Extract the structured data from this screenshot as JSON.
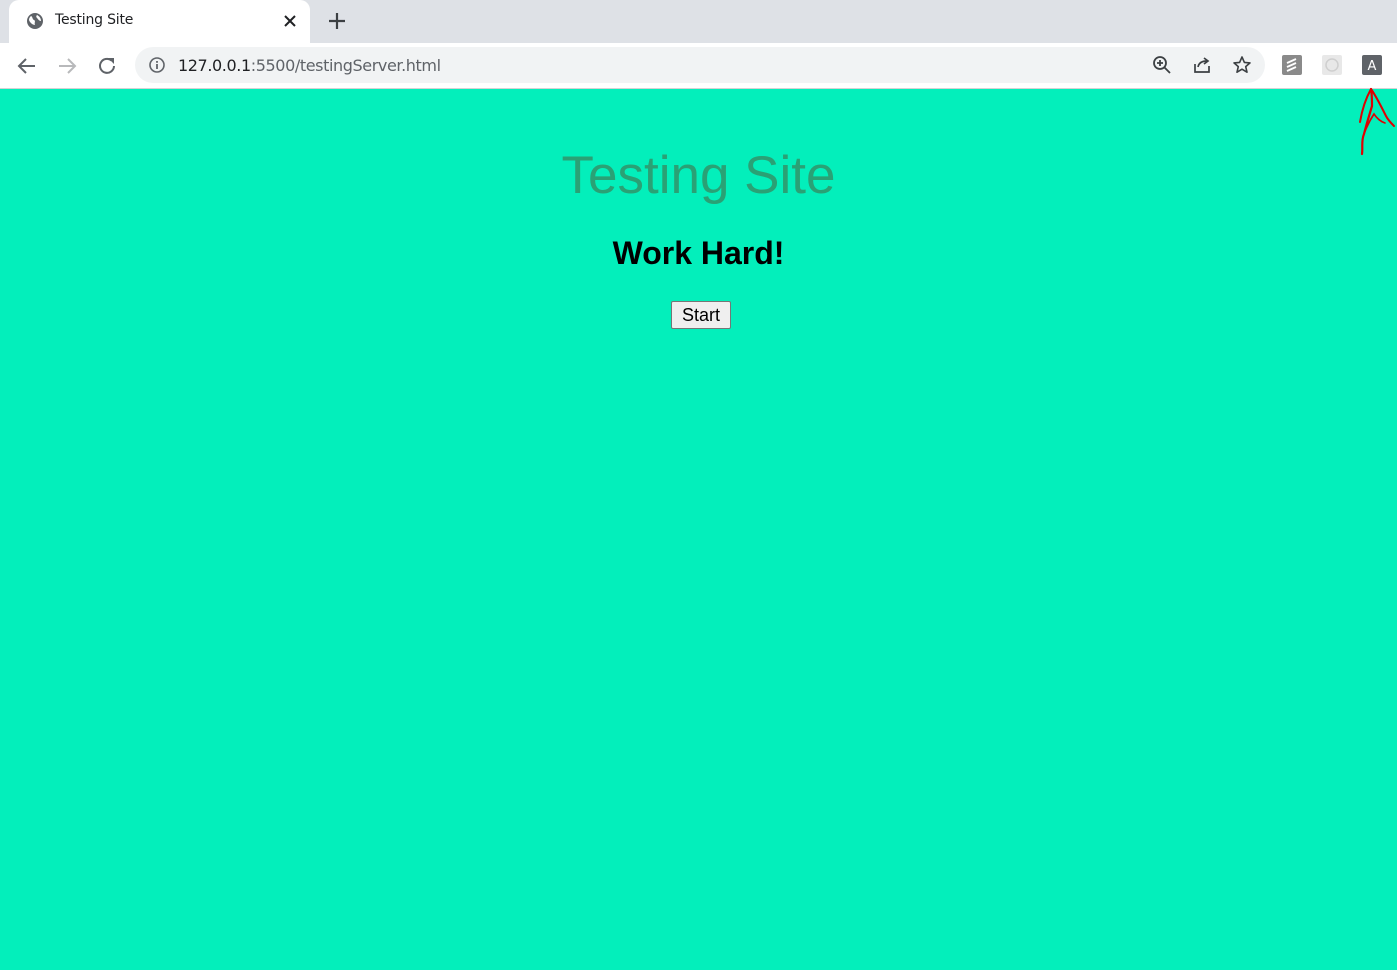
{
  "browser": {
    "tab": {
      "title": "Testing Site",
      "favicon": "globe-icon",
      "close_icon": "close-icon"
    },
    "new_tab_icon": "plus-icon",
    "nav": {
      "back_icon": "back-arrow-icon",
      "forward_icon": "forward-arrow-icon",
      "reload_icon": "reload-icon"
    },
    "address": {
      "host": "127.0.0.1",
      "path": ":5500/testingServer.html",
      "info_icon": "info-icon"
    },
    "omnibox_icons": [
      "zoom-icon",
      "share-icon",
      "bookmark-star-icon"
    ],
    "extensions": [
      "extension-1-icon",
      "extension-2-icon",
      "extension-a-icon"
    ],
    "extension_a_letter": "A"
  },
  "page": {
    "heading": "Testing Site",
    "subheading": "Work Hard!",
    "start_label": "Start",
    "colors": {
      "background": "#03efbb",
      "heading": "#2aa175",
      "annotation": "#e00000"
    }
  }
}
